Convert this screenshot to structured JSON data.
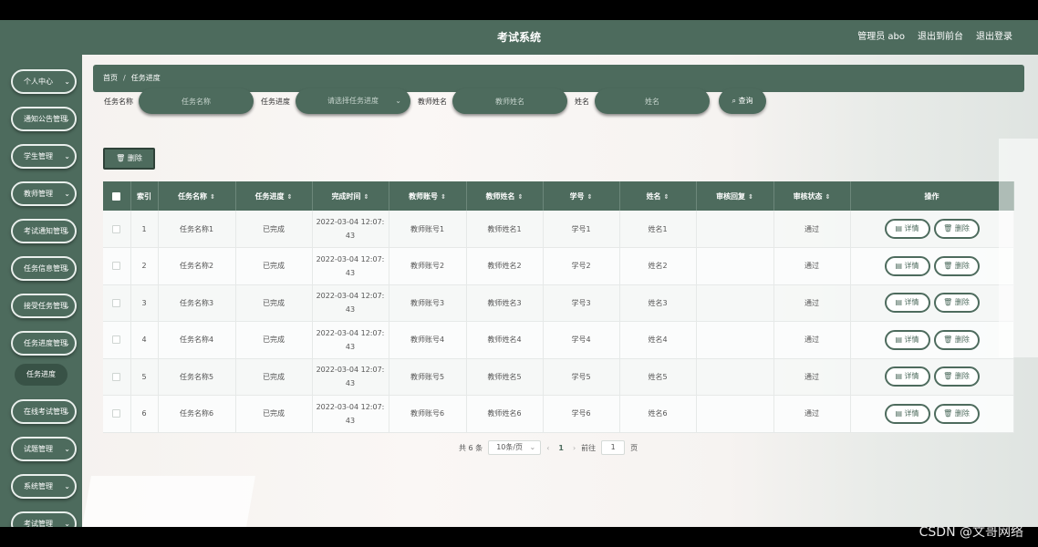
{
  "header": {
    "title": "考试系统",
    "user_label": "管理员 abo",
    "to_front_label": "退出到前台",
    "logout_label": "退出登录"
  },
  "sidebar": {
    "items": [
      {
        "label": "个人中心",
        "chev": "⌄"
      },
      {
        "label": "通知公告管理",
        "chev": "⌄"
      },
      {
        "label": "学生管理",
        "chev": "⌄"
      },
      {
        "label": "教师管理",
        "chev": "⌄"
      },
      {
        "label": "考试通知管理",
        "chev": "⌄"
      },
      {
        "label": "任务信息管理",
        "chev": "⌄"
      },
      {
        "label": "接受任务管理",
        "chev": "⌄"
      },
      {
        "label": "任务进度管理",
        "chev": "⌄"
      },
      {
        "label": "在线考试管理",
        "chev": "⌄"
      },
      {
        "label": "试题管理",
        "chev": "⌄"
      },
      {
        "label": "系统管理",
        "chev": "⌄"
      },
      {
        "label": "考试管理",
        "chev": "⌄"
      }
    ],
    "active_sub": "任务进度"
  },
  "breadcrumb": {
    "home": "首页",
    "separator": "/",
    "current": "任务进度"
  },
  "search": {
    "task_name_label": "任务名称",
    "task_name_placeholder": "任务名称",
    "progress_label": "任务进度",
    "progress_placeholder": "请选择任务进度",
    "teacher_name_label": "教师姓名",
    "teacher_name_placeholder": "教师姓名",
    "name_label": "姓名",
    "name_placeholder": "姓名",
    "query_label": "查询",
    "query_icon": "search-icon"
  },
  "toolbar": {
    "delete_label": "删除",
    "delete_icon": "trash-icon"
  },
  "table": {
    "columns": [
      "索引",
      "任务名称",
      "任务进度",
      "完成时间",
      "教师账号",
      "教师姓名",
      "学号",
      "姓名",
      "审核回复",
      "审核状态",
      "操作"
    ],
    "sort_glyph": "⇕",
    "detail_label": "详情",
    "delete_label": "删除",
    "rows": [
      {
        "index": "1",
        "task": "任务名称1",
        "progress": "已完成",
        "time_a": "2022-03-04 12:07:",
        "time_b": "43",
        "teacher_account": "教师账号1",
        "teacher_name": "教师姓名1",
        "student_no": "学号1",
        "name": "姓名1",
        "reply": "",
        "status": "通过"
      },
      {
        "index": "2",
        "task": "任务名称2",
        "progress": "已完成",
        "time_a": "2022-03-04 12:07:",
        "time_b": "43",
        "teacher_account": "教师账号2",
        "teacher_name": "教师姓名2",
        "student_no": "学号2",
        "name": "姓名2",
        "reply": "",
        "status": "通过"
      },
      {
        "index": "3",
        "task": "任务名称3",
        "progress": "已完成",
        "time_a": "2022-03-04 12:07:",
        "time_b": "43",
        "teacher_account": "教师账号3",
        "teacher_name": "教师姓名3",
        "student_no": "学号3",
        "name": "姓名3",
        "reply": "",
        "status": "通过"
      },
      {
        "index": "4",
        "task": "任务名称4",
        "progress": "已完成",
        "time_a": "2022-03-04 12:07:",
        "time_b": "43",
        "teacher_account": "教师账号4",
        "teacher_name": "教师姓名4",
        "student_no": "学号4",
        "name": "姓名4",
        "reply": "",
        "status": "通过"
      },
      {
        "index": "5",
        "task": "任务名称5",
        "progress": "已完成",
        "time_a": "2022-03-04 12:07:",
        "time_b": "43",
        "teacher_account": "教师账号5",
        "teacher_name": "教师姓名5",
        "student_no": "学号5",
        "name": "姓名5",
        "reply": "",
        "status": "通过"
      },
      {
        "index": "6",
        "task": "任务名称6",
        "progress": "已完成",
        "time_a": "2022-03-04 12:07:",
        "time_b": "43",
        "teacher_account": "教师账号6",
        "teacher_name": "教师姓名6",
        "student_no": "学号6",
        "name": "姓名6",
        "reply": "",
        "status": "通过"
      }
    ]
  },
  "pagination": {
    "total_label": "共 6 条",
    "page_size": "10条/页",
    "prev": "‹",
    "current_page": "1",
    "next": "›",
    "goto_label": "前往",
    "goto_value": "1",
    "page_suffix": "页"
  },
  "watermark": "CSDN @文哥网络",
  "colors": {
    "primary": "#4d6b5d",
    "primary_dark": "#385246"
  }
}
